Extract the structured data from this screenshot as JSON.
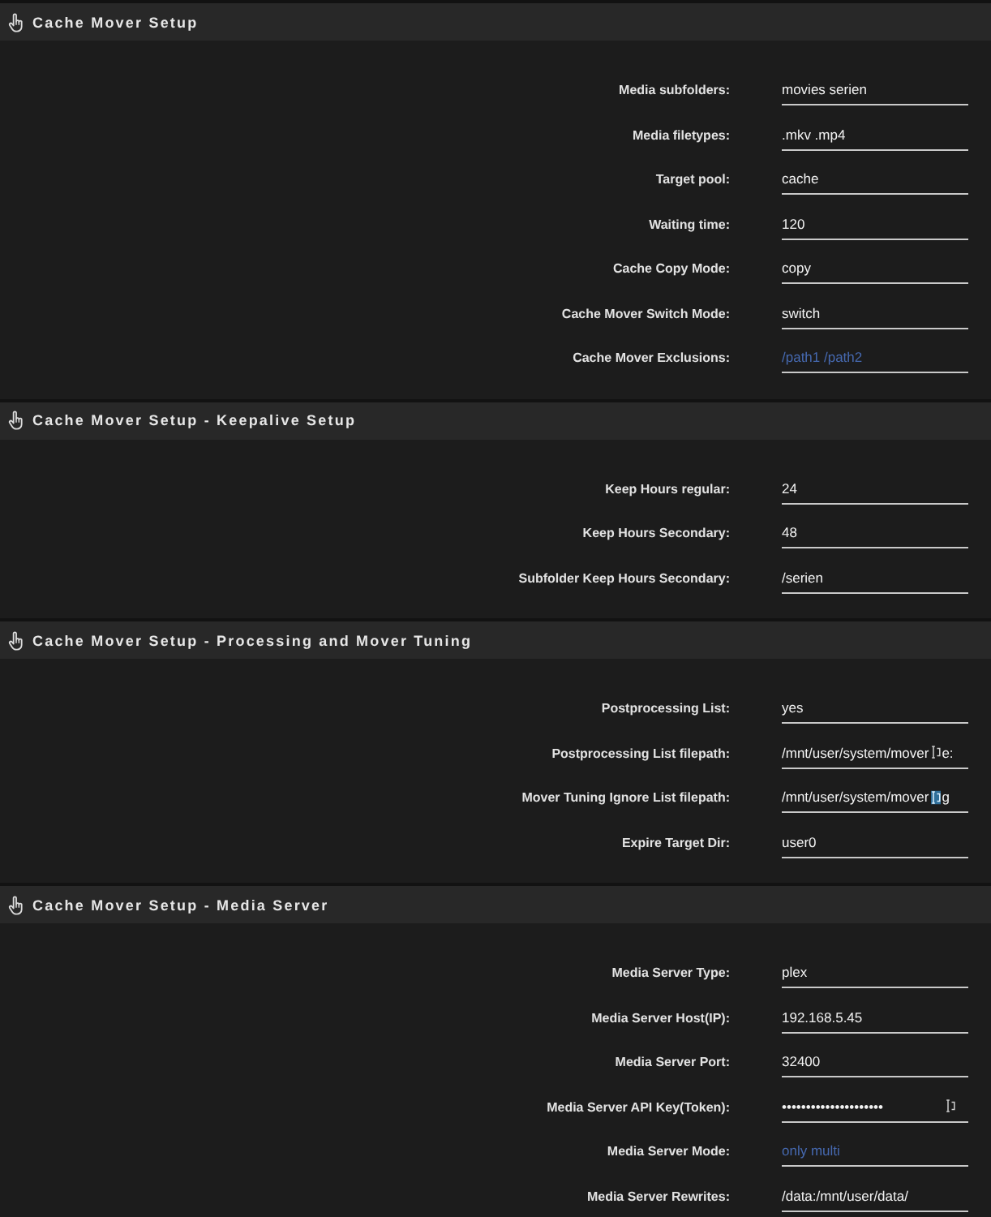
{
  "sections": [
    {
      "title": "Cache Mover Setup",
      "settings": [
        {
          "kind": "plain",
          "label": "Media subfolders:",
          "value": "movies serien"
        },
        {
          "kind": "plain",
          "label": "Media filetypes:",
          "value": ".mkv .mp4"
        },
        {
          "kind": "plain",
          "label": "Target pool:",
          "value": "cache"
        },
        {
          "kind": "plain",
          "label": "Waiting time:",
          "value": "120"
        },
        {
          "kind": "plain",
          "label": "Cache Copy Mode:",
          "value": "copy"
        },
        {
          "kind": "plain",
          "label": "Cache Mover Switch Mode:",
          "value": "switch"
        },
        {
          "kind": "plain",
          "label": "Cache Mover Exclusions:",
          "placeholder": "/path1 /path2"
        }
      ]
    },
    {
      "title": "Cache Mover Setup - Keepalive Setup",
      "settings": [
        {
          "kind": "plain",
          "label": "Keep Hours regular:",
          "value": "24"
        },
        {
          "kind": "plain",
          "label": "Keep Hours Secondary:",
          "value": "48"
        },
        {
          "kind": "plain",
          "label": "Subfolder Keep Hours Secondary:",
          "value": "/serien"
        }
      ]
    },
    {
      "title": "Cache Mover Setup - Processing and Mover Tuning",
      "settings": [
        {
          "kind": "plain",
          "label": "Postprocessing List:",
          "value": "yes"
        },
        {
          "kind": "path",
          "label": "Postprocessing List filepath:",
          "value": "/mnt/user/system/mover",
          "icon_active": false,
          "tail": "e:"
        },
        {
          "kind": "path",
          "label": "Mover Tuning Ignore List filepath:",
          "value": "/mnt/user/system/mover",
          "icon_active": true,
          "tail": "g"
        },
        {
          "kind": "plain",
          "label": "Expire Target Dir:",
          "value": "user0"
        }
      ]
    },
    {
      "title": "Cache Mover Setup - Media Server",
      "settings": [
        {
          "kind": "plain",
          "label": "Media Server Type:",
          "value": "plex"
        },
        {
          "kind": "plain",
          "label": "Media Server Host(IP):",
          "value": "192.168.5.45"
        },
        {
          "kind": "plain",
          "label": "Media Server Port:",
          "value": "32400"
        },
        {
          "kind": "secret",
          "label": "Media Server API Key(Token):",
          "value": "•••••••••••••••••••••",
          "icon_active": false
        },
        {
          "kind": "plain",
          "label": "Media Server Mode:",
          "placeholder": "only multi"
        },
        {
          "kind": "plain",
          "label": "Media Server Rewrites:",
          "value": "/data:/mnt/user/data/"
        }
      ]
    }
  ]
}
